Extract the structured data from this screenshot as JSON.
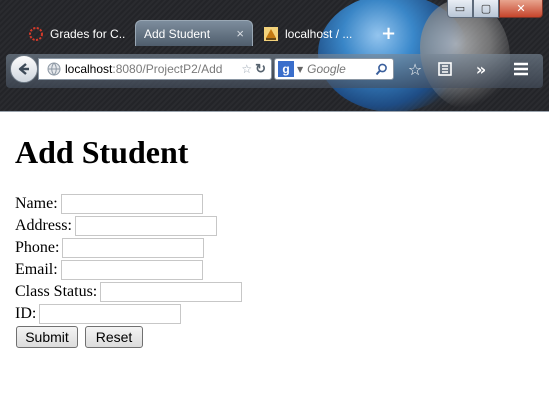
{
  "window": {
    "controls": {
      "minimize": "▭",
      "maximize": "▢",
      "close": "✕"
    }
  },
  "tabs": [
    {
      "label": "Grades for C...",
      "icon": "ring-logo-icon",
      "active": false
    },
    {
      "label": "Add Student",
      "icon": "",
      "active": true,
      "close": "×"
    },
    {
      "label": "localhost / ...",
      "icon": "phpmyadmin-icon",
      "active": false
    }
  ],
  "new_tab": "+",
  "navbar": {
    "url_host": "localhost",
    "url_rest": ":8080/ProjectP2/Add",
    "search_engine_letter": "g",
    "search_placeholder": "Google"
  },
  "page": {
    "title": "Add Student",
    "fields": [
      {
        "label": "Name:",
        "value": ""
      },
      {
        "label": "Address:",
        "value": ""
      },
      {
        "label": "Phone:",
        "value": ""
      },
      {
        "label": "Email:",
        "value": ""
      },
      {
        "label": "Class Status:",
        "value": ""
      },
      {
        "label": "ID:",
        "value": ""
      }
    ],
    "submit_label": "Submit",
    "reset_label": "Reset"
  },
  "colors": {
    "accent_tab": "#4f5d6c",
    "close_button": "#c6452c",
    "page_background": "#ffffff"
  }
}
